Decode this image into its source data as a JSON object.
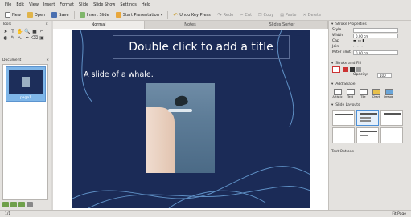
{
  "menu": [
    "File",
    "Edit",
    "View",
    "Insert",
    "Format",
    "Slide",
    "Slide Show",
    "Settings",
    "Help"
  ],
  "toolbar": {
    "new": "New",
    "open": "Open",
    "save": "Save",
    "insert_slide": "Insert Slide",
    "start_presentation": "Start Presentation",
    "undo": "Undo Key Press",
    "redo": "Redo",
    "cut": "Cut",
    "copy": "Copy",
    "paste": "Paste",
    "delete": "Delete"
  },
  "left_dock": {
    "tools_title": "Tools",
    "document_title": "Document",
    "thumb_label": "page1"
  },
  "tabs": [
    "Normal",
    "Notes",
    "Slides Sorter"
  ],
  "slide": {
    "title_placeholder": "Double click to add a title",
    "body_text": "A slide of a whale."
  },
  "right_dock": {
    "stroke_title": "Stroke Properties",
    "style_label": "Style",
    "width_label": "Width",
    "width_value": "0.00 cm",
    "cap_label": "Cap",
    "join_label": "Join",
    "miter_label": "Miter limit:",
    "miter_value": "0.00 cm",
    "stroke_fill_title": "Stroke and Fill",
    "opacity_label": "Opacity:",
    "opacity_value": "100",
    "add_shape_title": "Add Shape",
    "shapes": [
      "Artistic",
      "Text",
      "Tile",
      "Chart",
      "Image"
    ],
    "layouts_title": "Slide Layouts",
    "text_options_title": "Text Options"
  },
  "status": {
    "page": "1/1",
    "zoom": "Fit Page"
  },
  "colors": {
    "slide_bg": "#1b2b57",
    "accent": "#6fa8e0"
  }
}
